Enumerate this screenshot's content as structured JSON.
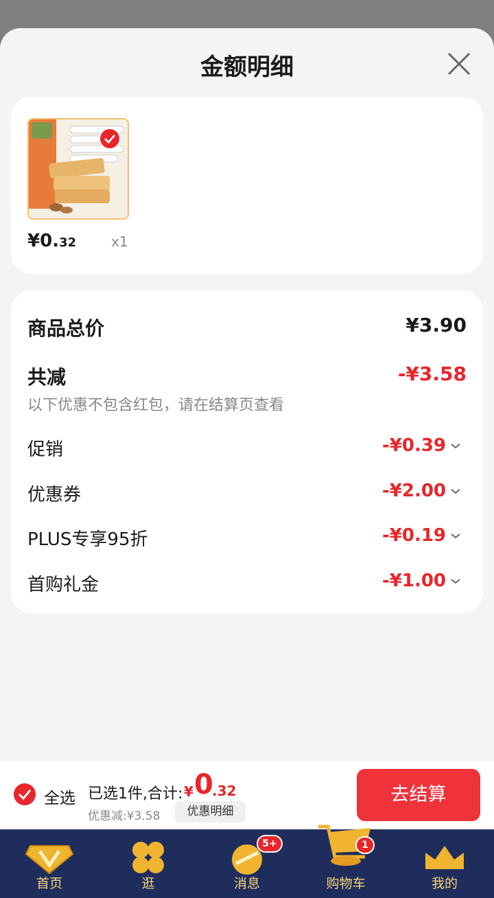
{
  "title": "金额明细",
  "product": {
    "price_int": "¥0.",
    "price_dec": "32",
    "qty": "x1"
  },
  "summary": {
    "total_label": "商品总价",
    "total_value": "¥3.90",
    "reduce_label": "共减",
    "reduce_value": "-¥3.58",
    "note": "以下优惠不包含红包，请在结算页查看",
    "rows": [
      {
        "label": "促销",
        "value": "-¥0.39"
      },
      {
        "label": "优惠券",
        "value": "-¥2.00"
      },
      {
        "label": "PLUS专享95折",
        "value": "-¥0.19"
      },
      {
        "label": "首购礼金",
        "value": "-¥1.00"
      }
    ]
  },
  "checkout": {
    "select_all": "全选",
    "selected": "已选1件,合计:",
    "yen": "¥",
    "sum_int": "0",
    "sum_dec": ".32",
    "discount": "优惠减:¥3.58",
    "detail": "优惠明细",
    "button": "去结算"
  },
  "tabs": [
    {
      "label": "首页",
      "icon": "home-v-icon"
    },
    {
      "label": "逛",
      "icon": "browse-icon"
    },
    {
      "label": "消息",
      "icon": "message-icon",
      "badge": "5+"
    },
    {
      "label": "购物车",
      "icon": "cart-icon",
      "badge": "1"
    },
    {
      "label": "我的",
      "icon": "crown-icon"
    }
  ],
  "colors": {
    "accent": "#e8262b",
    "tabbar": "#1f2d5c",
    "tab_text": "#f5d37a"
  }
}
